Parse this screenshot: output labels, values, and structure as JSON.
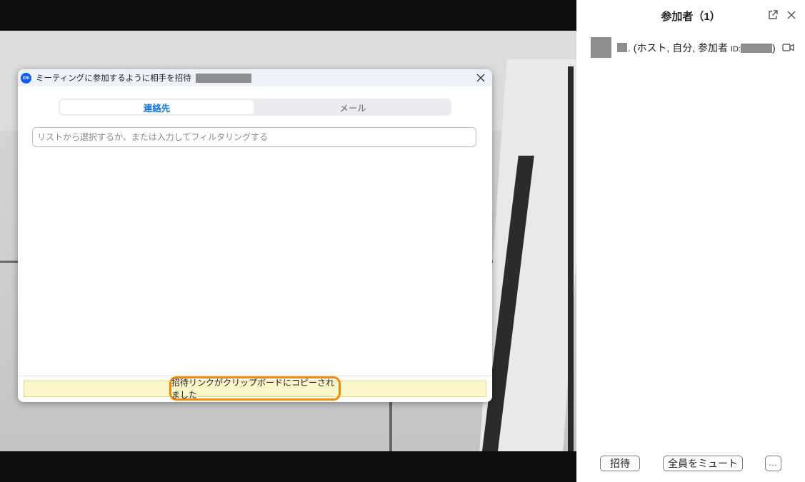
{
  "invite_dialog": {
    "title": "ミーティングに参加するように相手を招待",
    "logo_text": "zm",
    "tabs": [
      {
        "label": "連絡先",
        "active": true
      },
      {
        "label": "メール",
        "active": false
      }
    ],
    "filter_input": {
      "value": "",
      "placeholder": "リストから選択するか、または入力してフィルタリングする"
    },
    "notice": "招待リンクがクリップボードにコピーされました",
    "colors": {
      "active_tab": "#0e72ed",
      "notice_bg": "#fbf7c8",
      "highlight_border": "#f58a07",
      "logo": "#0b5cff"
    }
  },
  "participants_panel": {
    "title": "参加者（1）",
    "participants": [
      {
        "label": ". (ホスト, 自分, 参加者",
        "id_label": "ID:",
        "id_suffix": ")"
      }
    ],
    "buttons": {
      "invite": "招待",
      "mute_all": "全員をミュート",
      "more": "..."
    }
  },
  "icons": [
    "zoom-logo-icon",
    "close-icon",
    "popout-icon",
    "video-camera-icon"
  ]
}
